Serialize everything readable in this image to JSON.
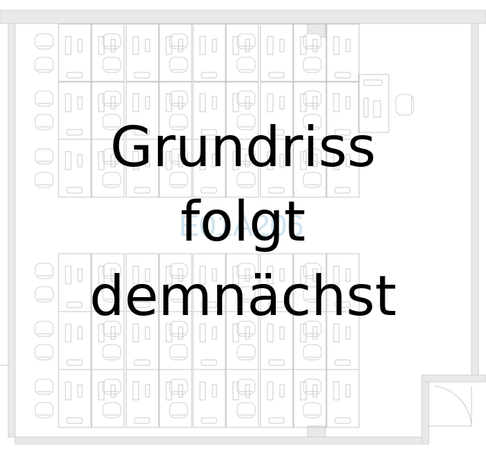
{
  "floorplan": {
    "room_label": "E01A206",
    "overlay_lines": [
      "Grundriss",
      "folgt",
      "demnächst"
    ],
    "colors": {
      "wall": "#e9e9e9",
      "furniture": "#c6c6c6",
      "room_label": "#cfe3f0",
      "overlay_text": "#000000"
    }
  }
}
